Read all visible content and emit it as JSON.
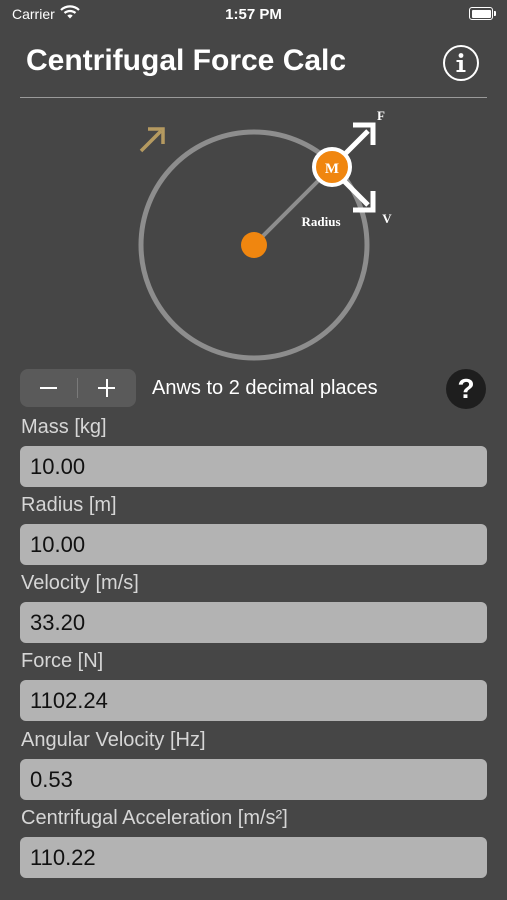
{
  "status_bar": {
    "carrier": "Carrier",
    "time": "1:57 PM"
  },
  "header": {
    "title": "Centrifugal Force Calc",
    "info_icon": "info-icon"
  },
  "diagram": {
    "mass_label": "M",
    "force_label": "F",
    "velocity_label": "V",
    "radius_label": "Radius",
    "colors": {
      "orange": "#f0860f",
      "rotation_arrow": "#b59a60",
      "circle": "#8d8d8d"
    }
  },
  "controls": {
    "decimals_label": "Anws to 2 decimal places",
    "help_label": "?"
  },
  "fields": [
    {
      "label": "Mass [kg]",
      "value": "10.00"
    },
    {
      "label": "Radius [m]",
      "value": "10.00"
    },
    {
      "label": "Velocity [m/s]",
      "value": "33.20"
    },
    {
      "label": "Force [N]",
      "value": "1102.24"
    },
    {
      "label": "Angular Velocity [Hz]",
      "value": "0.53"
    },
    {
      "label": "Centrifugal Acceleration [m/s²]",
      "value": "110.22"
    }
  ]
}
